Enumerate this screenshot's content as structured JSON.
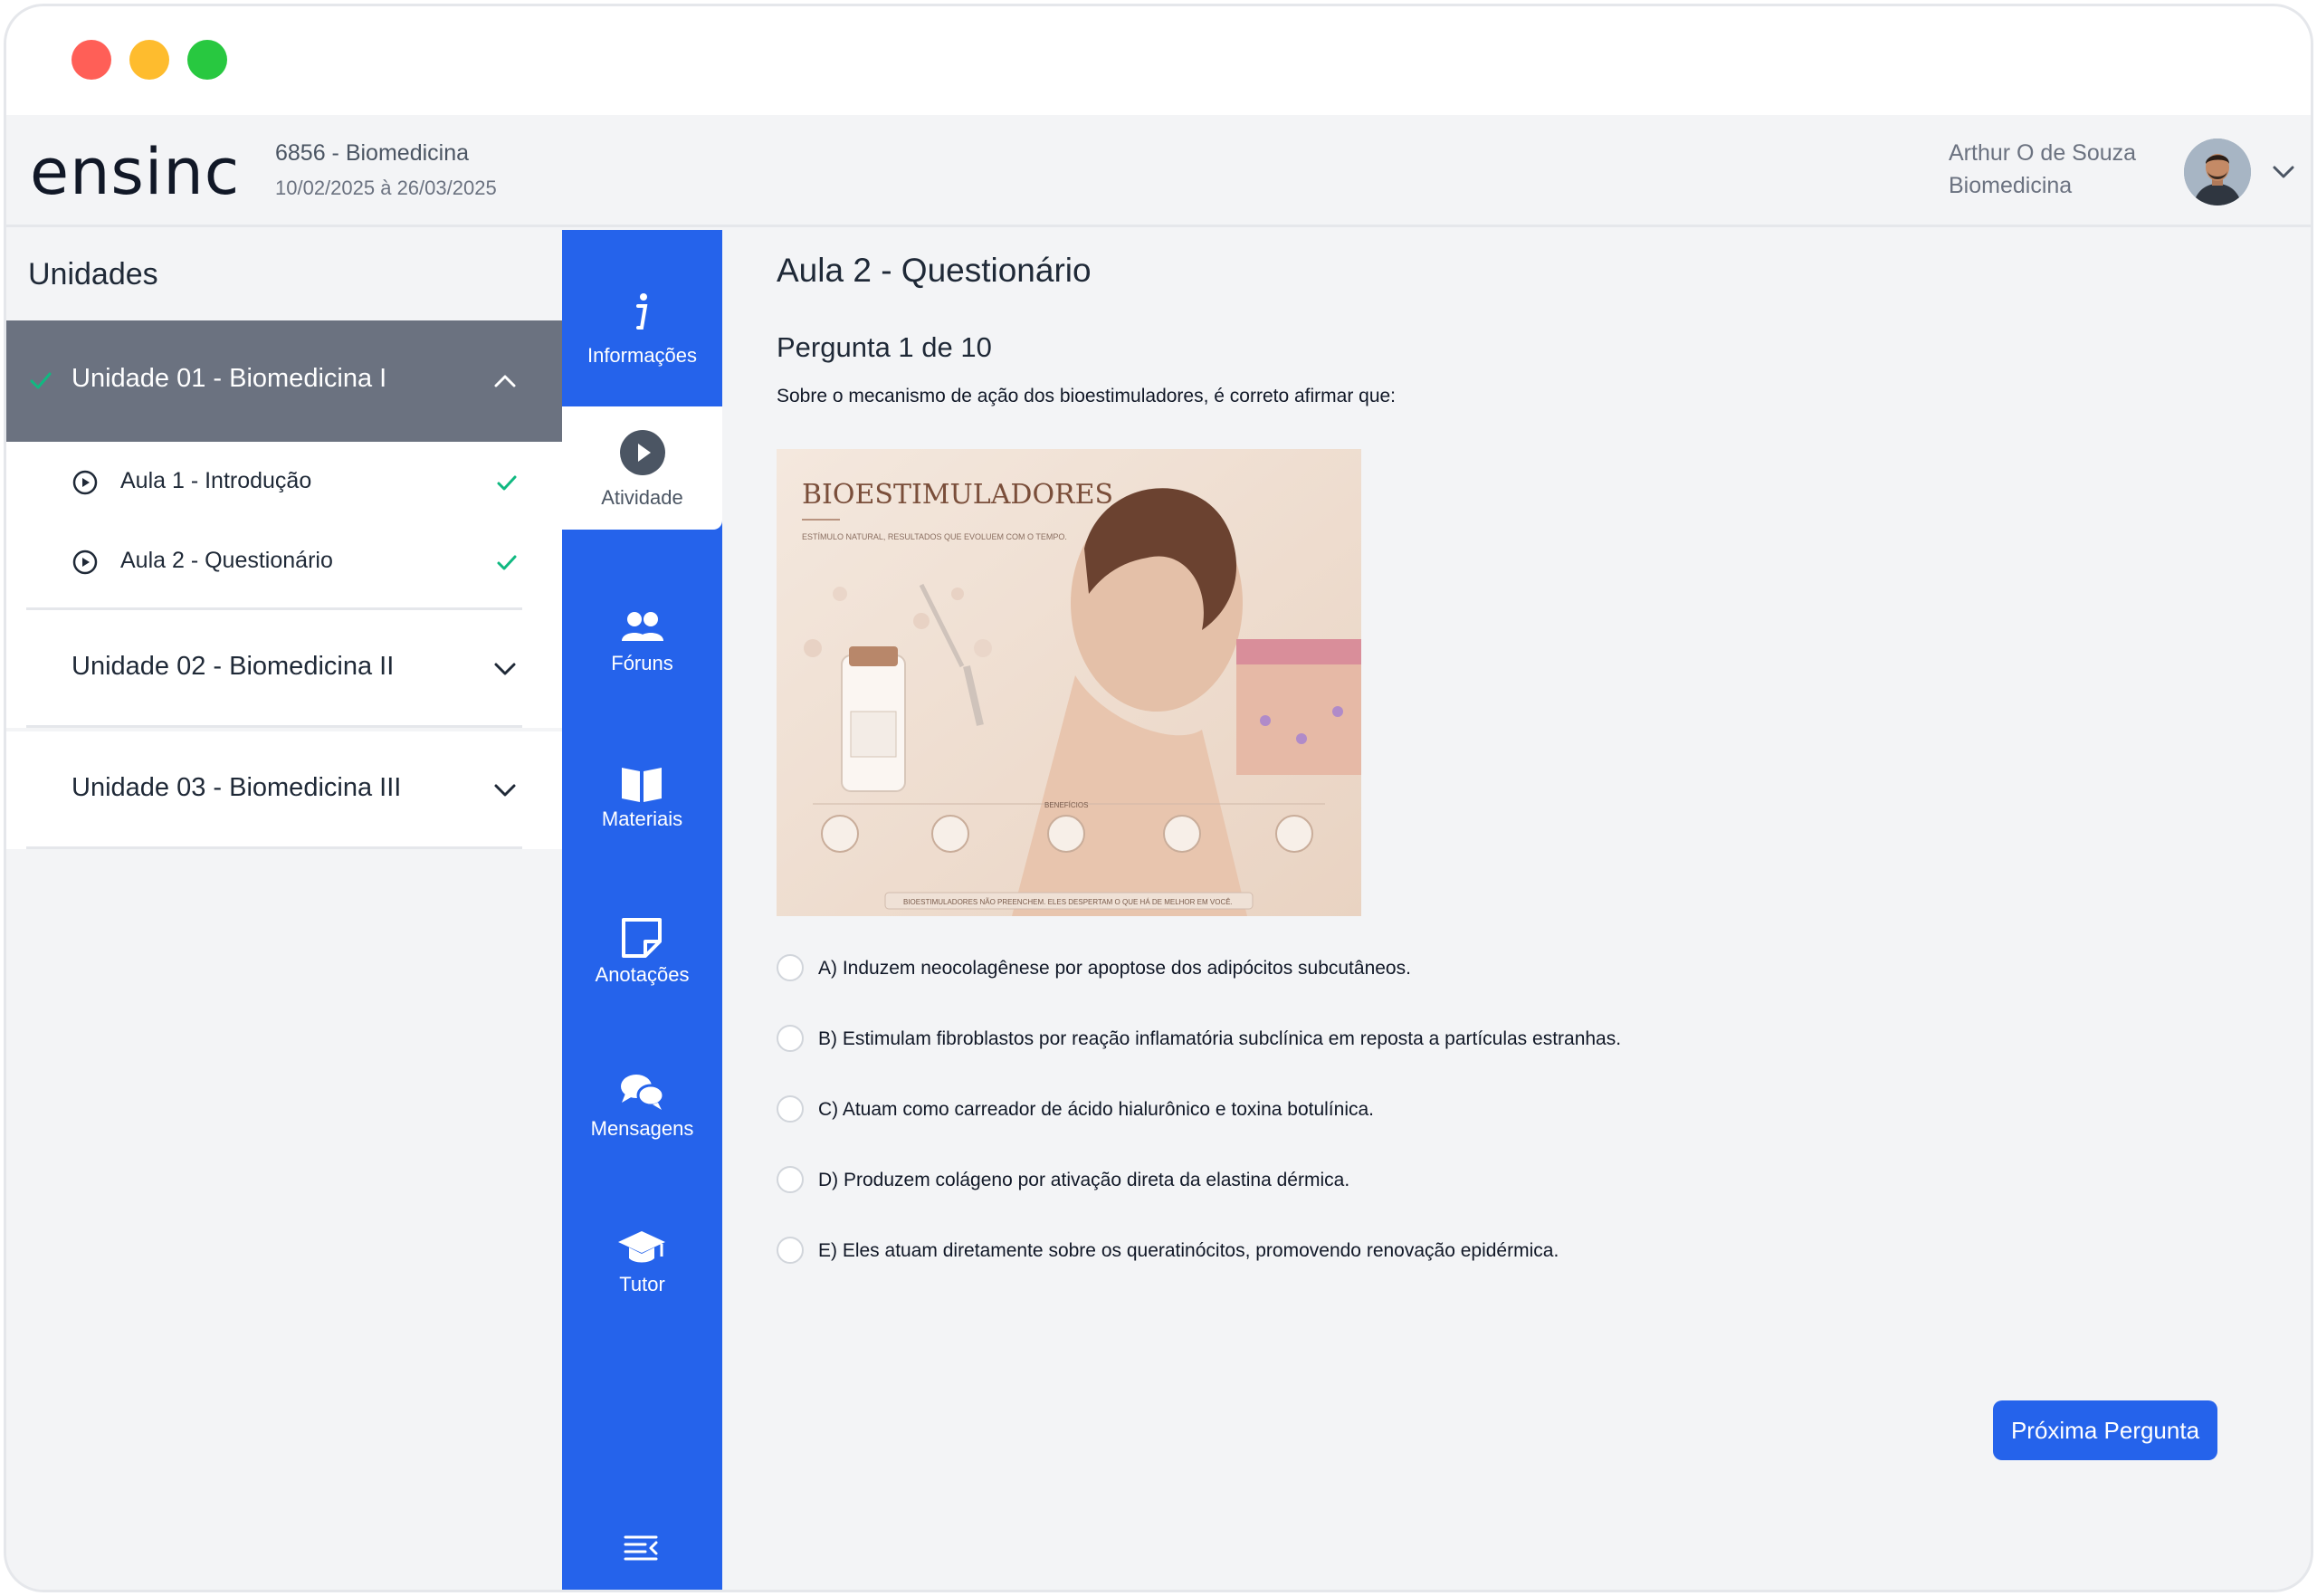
{
  "header": {
    "logo": "ensinc",
    "course": "6856 - Biomedicina",
    "dates": "10/02/2025 à 26/03/2025",
    "user_name": "Arthur O de Souza",
    "user_course": "Biomedicina"
  },
  "sidebar": {
    "title": "Unidades",
    "units": [
      {
        "label": "Unidade 01 - Biomedicina I",
        "expanded": true,
        "completed": true,
        "lessons": [
          {
            "label": "Aula 1 - Introdução",
            "completed": true
          },
          {
            "label": "Aula 2 - Questionário",
            "completed": true
          }
        ]
      },
      {
        "label": "Unidade 02 - Biomedicina II",
        "expanded": false
      },
      {
        "label": "Unidade 03 - Biomedicina III",
        "expanded": false
      }
    ]
  },
  "rail": {
    "items": [
      {
        "label": "Informações",
        "icon": "info-icon"
      },
      {
        "label": "Atividade",
        "icon": "play-circle-icon",
        "active": true
      },
      {
        "label": "Fóruns",
        "icon": "users-icon"
      },
      {
        "label": "Materiais",
        "icon": "book-icon"
      },
      {
        "label": "Anotações",
        "icon": "note-icon"
      },
      {
        "label": "Mensagens",
        "icon": "chat-icon"
      },
      {
        "label": "Tutor",
        "icon": "graduation-cap-icon"
      }
    ]
  },
  "content": {
    "page_title": "Aula 2 - Questionário",
    "question_title": "Pergunta 1 de 10",
    "question_text": "Sobre o mecanismo de ação dos bioestimuladores, é correto afirmar que:",
    "image": {
      "heading": "BIOESTIMULADORES",
      "subheading": "ESTÍMULO NATURAL, RESULTADOS QUE EVOLUEM COM O TEMPO.",
      "benefits_label": "BENEFÍCIOS",
      "footer": "BIOESTIMULADORES NÃO PREENCHEM. ELES DESPERTAM O QUE HÁ DE MELHOR EM VOCÊ."
    },
    "options": [
      "A) Induzem neocolagênese por apoptose dos adipócitos subcutâneos.",
      "B) Estimulam fibroblastos por reação inflamatória subclínica em reposta a partículas estranhas.",
      "C) Atuam como carreador de ácido hialurônico e toxina botulínica.",
      "D) Produzem colágeno por ativação direta da elastina dérmica.",
      "E) Eles atuam diretamente sobre os queratinócitos, promovendo renovação epidérmica."
    ],
    "next_button": "Próxima Pergunta"
  },
  "colors": {
    "accent": "#2563eb",
    "check": "#10b981",
    "active_unit_bg": "#6b7280"
  }
}
